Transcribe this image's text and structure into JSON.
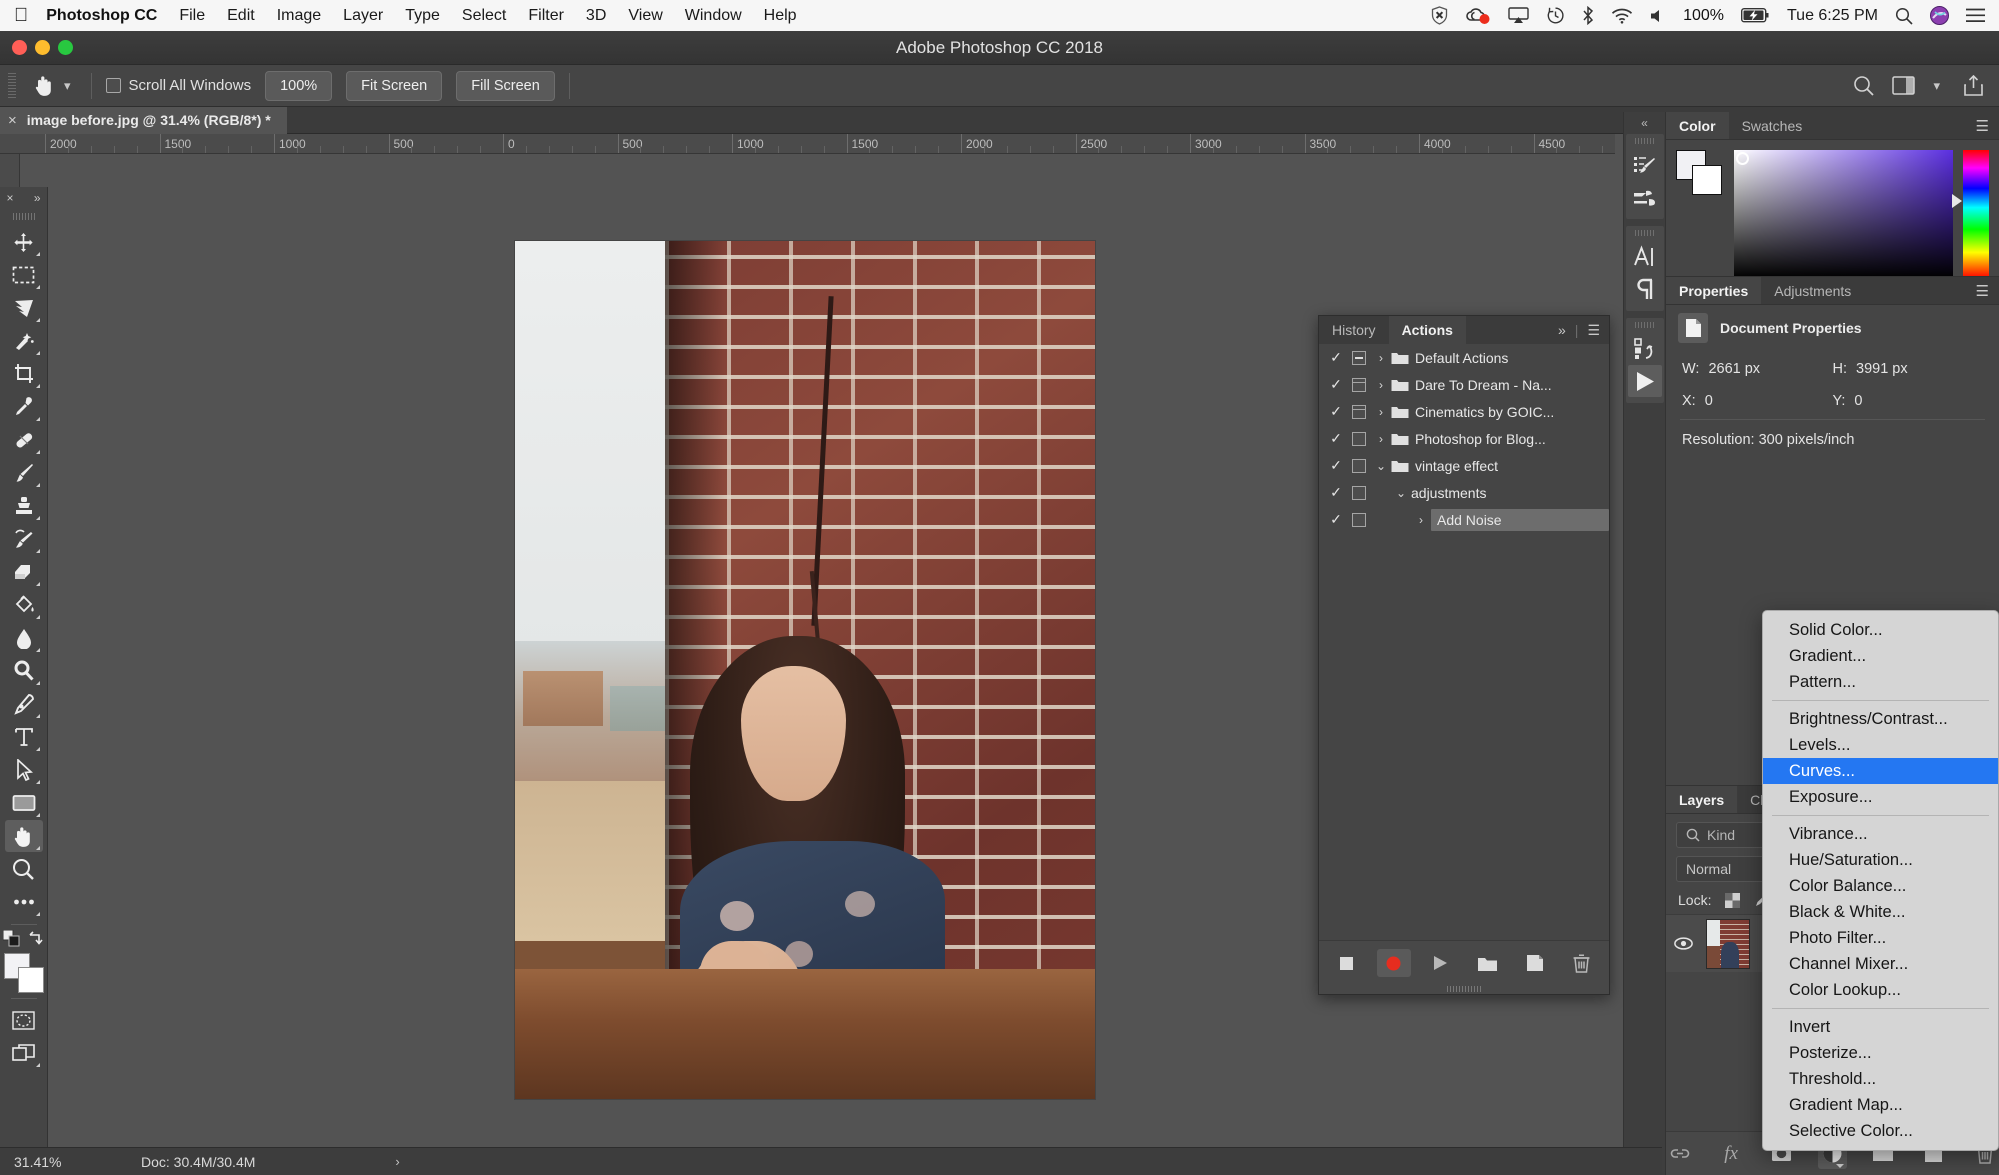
{
  "menubar": {
    "apple_icon": "apple-logo",
    "app_name": "Photoshop CC",
    "items": [
      "File",
      "Edit",
      "Image",
      "Layer",
      "Type",
      "Select",
      "Filter",
      "3D",
      "View",
      "Window",
      "Help"
    ],
    "status_icons": [
      "shield-x-icon",
      "creative-cloud-icon",
      "airplay-icon",
      "time-machine-icon",
      "bluetooth-icon",
      "wifi-icon",
      "volume-icon"
    ],
    "battery_percent": "100%",
    "clock": "Tue 6:25 PM",
    "spotlight_icon": "search-icon",
    "siri_icon": "siri-icon",
    "control_center_icon": "list-icon"
  },
  "window": {
    "title": "Adobe Photoshop CC 2018"
  },
  "options_bar": {
    "tool_icon": "hand-tool-icon",
    "scroll_all_windows_label": "Scroll All Windows",
    "zoom_100_label": "100%",
    "fit_screen_label": "Fit Screen",
    "fill_screen_label": "Fill Screen",
    "right_icons": [
      "search-icon",
      "workspace-icon",
      "chevron-down-icon",
      "share-icon"
    ]
  },
  "document_tab": {
    "close_glyph": "×",
    "title": "image before.jpg @ 31.4% (RGB/8*) *"
  },
  "rulers": {
    "horizontal_labels": [
      "2000",
      "1500",
      "1000",
      "500",
      "0",
      "500",
      "1000",
      "1500",
      "2000",
      "2500",
      "3000",
      "3500",
      "4000",
      "4500"
    ]
  },
  "toolbar": {
    "close_glyph": "×",
    "expand_glyph": "»",
    "tools": [
      {
        "name": "move-tool",
        "label": "Move Tool"
      },
      {
        "name": "rectangular-marquee-tool",
        "label": "Rectangular Marquee Tool"
      },
      {
        "name": "lasso-tool",
        "label": "Lasso Tool"
      },
      {
        "name": "quick-selection-tool",
        "label": "Quick Selection Tool"
      },
      {
        "name": "crop-tool",
        "label": "Crop Tool"
      },
      {
        "name": "eyedropper-tool",
        "label": "Eyedropper Tool"
      },
      {
        "name": "spot-healing-brush-tool",
        "label": "Spot Healing Brush Tool"
      },
      {
        "name": "brush-tool",
        "label": "Brush Tool"
      },
      {
        "name": "clone-stamp-tool",
        "label": "Clone Stamp Tool"
      },
      {
        "name": "history-brush-tool",
        "label": "History Brush Tool"
      },
      {
        "name": "eraser-tool",
        "label": "Eraser Tool"
      },
      {
        "name": "paint-bucket-tool",
        "label": "Paint Bucket Tool"
      },
      {
        "name": "blur-tool",
        "label": "Blur Tool"
      },
      {
        "name": "dodge-tool",
        "label": "Dodge Tool"
      },
      {
        "name": "pen-tool",
        "label": "Pen Tool"
      },
      {
        "name": "type-tool",
        "label": "Horizontal Type Tool"
      },
      {
        "name": "path-selection-tool",
        "label": "Path Selection Tool"
      },
      {
        "name": "rectangle-tool",
        "label": "Rectangle Tool"
      },
      {
        "name": "hand-tool",
        "label": "Hand Tool"
      },
      {
        "name": "zoom-tool",
        "label": "Zoom Tool"
      },
      {
        "name": "edit-toolbar-tool",
        "label": "Edit Toolbar"
      }
    ],
    "active_tool": "hand-tool",
    "foreground_color": "#f1f1f4",
    "background_color": "#ffffff",
    "quick_mask_label": "Edit in Quick Mask Mode",
    "screen_mode_label": "Change Screen Mode"
  },
  "actions_panel": {
    "tabs": [
      {
        "label": "History",
        "active": false
      },
      {
        "label": "Actions",
        "active": true
      }
    ],
    "collapse_glyph": "»",
    "menu_glyph": "☰",
    "rows": [
      {
        "label": "Default Actions",
        "check": "✓",
        "toggle": "minus",
        "arrow": "›",
        "folder": true,
        "indent": 0,
        "highlight": false
      },
      {
        "label": "Dare To Dream - Na...",
        "check": "✓",
        "toggle": "bar",
        "arrow": "›",
        "folder": true,
        "indent": 0,
        "highlight": false
      },
      {
        "label": "Cinematics by GOIC...",
        "check": "✓",
        "toggle": "bar",
        "arrow": "›",
        "folder": true,
        "indent": 0,
        "highlight": false
      },
      {
        "label": "Photoshop for Blog...",
        "check": "✓",
        "toggle": "empty",
        "arrow": "›",
        "folder": true,
        "indent": 0,
        "highlight": false
      },
      {
        "label": "vintage effect",
        "check": "✓",
        "toggle": "empty",
        "arrow": "⌄",
        "folder": true,
        "indent": 0,
        "highlight": false
      },
      {
        "label": "adjustments",
        "check": "✓",
        "toggle": "empty",
        "arrow": "⌄",
        "folder": false,
        "indent": 1,
        "highlight": false
      },
      {
        "label": "Add Noise",
        "check": "✓",
        "toggle": "empty",
        "arrow": "›",
        "folder": false,
        "indent": 2,
        "highlight": true
      }
    ],
    "footer_buttons": [
      {
        "name": "stop-playing-button",
        "label": "Stop"
      },
      {
        "name": "begin-recording-button",
        "label": "Record"
      },
      {
        "name": "play-selection-button",
        "label": "Play"
      },
      {
        "name": "create-new-set-button",
        "label": "New Set"
      },
      {
        "name": "create-new-action-button",
        "label": "New Action"
      },
      {
        "name": "delete-button",
        "label": "Delete"
      }
    ]
  },
  "icon_dock": {
    "collapse_glyph": "«",
    "groups": [
      [
        "brush-settings-icon",
        "brush-presets-icon"
      ],
      [
        "character-icon",
        "paragraph-icon"
      ],
      [
        "layer-comps-icon",
        "play-icon"
      ]
    ],
    "active_icon": "play-icon"
  },
  "color_panel": {
    "tabs": [
      {
        "label": "Color",
        "active": true
      },
      {
        "label": "Swatches",
        "active": false
      }
    ],
    "menu_glyph": "☰",
    "foreground_color": "#f1f1f4",
    "background_color": "#ffffff",
    "picker_hue_color": "#5b2fe0"
  },
  "properties_panel": {
    "tabs": [
      {
        "label": "Properties",
        "active": true
      },
      {
        "label": "Adjustments",
        "active": false
      }
    ],
    "menu_glyph": "☰",
    "header_icon": "document-icon",
    "header_title": "Document Properties",
    "fields": [
      {
        "label": "W:",
        "value": "2661 px"
      },
      {
        "label": "H:",
        "value": "3991 px"
      },
      {
        "label": "X:",
        "value": "0"
      },
      {
        "label": "Y:",
        "value": "0"
      }
    ],
    "resolution": "Resolution: 300 pixels/inch"
  },
  "layers_panel": {
    "tabs": [
      {
        "label": "Layers",
        "active": true
      },
      {
        "label": "Ch",
        "active": false
      }
    ],
    "search_icon": "search-icon",
    "search_placeholder": "Kind",
    "blend_mode": "Normal",
    "lock_label": "Lock:",
    "lock_icons": [
      "transparency-lock-icon",
      "image-lock-icon"
    ],
    "layer_row": {
      "eye_icon": "eye-icon",
      "thumbnail": "layer-thumbnail"
    },
    "footer_buttons": [
      {
        "name": "link-layers-button",
        "label": "Link layers"
      },
      {
        "name": "layer-style-button",
        "label": "fx"
      },
      {
        "name": "layer-mask-button",
        "label": "Add layer mask"
      },
      {
        "name": "adjustment-layer-button",
        "label": "New fill or adjustment layer"
      },
      {
        "name": "new-group-button",
        "label": "Create a new group"
      },
      {
        "name": "new-layer-button",
        "label": "Create a new layer"
      },
      {
        "name": "delete-layer-button",
        "label": "Delete layer"
      }
    ],
    "active_footer_button": "adjustment-layer-button"
  },
  "context_menu": {
    "groups": [
      [
        "Solid Color...",
        "Gradient...",
        "Pattern..."
      ],
      [
        "Brightness/Contrast...",
        "Levels...",
        "Curves...",
        "Exposure..."
      ],
      [
        "Vibrance...",
        "Hue/Saturation...",
        "Color Balance...",
        "Black & White...",
        "Photo Filter...",
        "Channel Mixer...",
        "Color Lookup..."
      ],
      [
        "Invert",
        "Posterize...",
        "Threshold...",
        "Gradient Map...",
        "Selective Color..."
      ]
    ],
    "selected_item": "Curves...",
    "highlight_color": "#2477f2"
  },
  "status_bar": {
    "zoom": "31.41%",
    "doc_info": "Doc: 30.4M/30.4M",
    "arrow_glyph": "›"
  },
  "colors": {
    "app_bg": "#535353",
    "panel_bg": "#454545",
    "panel_tab_bg": "#3b3b3b",
    "text": "#e8e8e8",
    "accent_blue": "#2477f2",
    "record_red": "#e03535"
  }
}
